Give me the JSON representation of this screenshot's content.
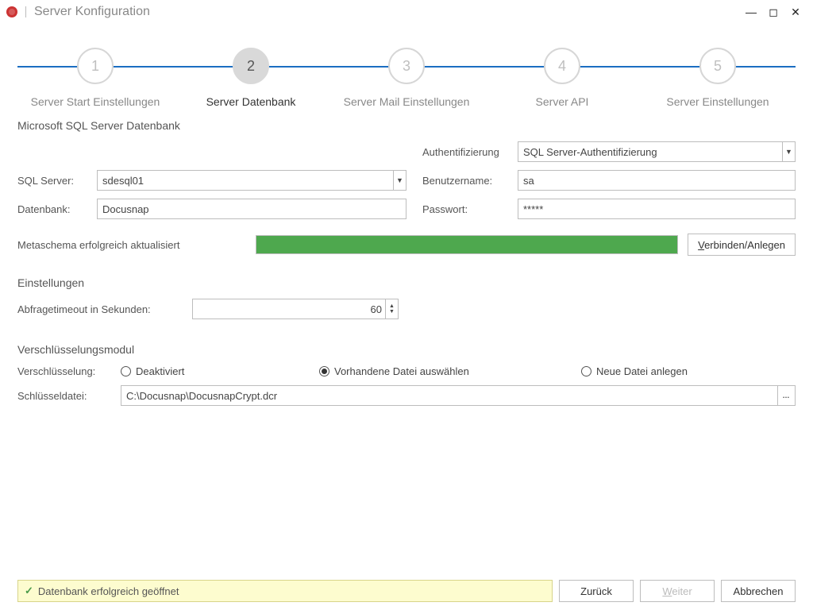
{
  "window": {
    "title": "Server Konfiguration"
  },
  "stepper": {
    "steps": [
      {
        "num": "1",
        "label": "Server Start Einstellungen"
      },
      {
        "num": "2",
        "label": "Server Datenbank"
      },
      {
        "num": "3",
        "label": "Server Mail Einstellungen"
      },
      {
        "num": "4",
        "label": "Server API"
      },
      {
        "num": "5",
        "label": "Server Einstellungen"
      }
    ],
    "active_index": 1
  },
  "db": {
    "section_title": "Microsoft SQL Server Datenbank",
    "auth_label": "Authentifizierung",
    "auth_value": "SQL Server-Authentifizierung",
    "sqlserver_label": "SQL Server:",
    "sqlserver_value": "sdesql01",
    "dbname_label": "Datenbank:",
    "dbname_value": "Docusnap",
    "user_label": "Benutzername:",
    "user_value": "sa",
    "pass_label": "Passwort:",
    "pass_value": "*****",
    "connect_button": "Verbinden/Anlegen",
    "meta_status": "Metaschema erfolgreich aktualisiert"
  },
  "settings": {
    "section_title": "Einstellungen",
    "timeout_label": "Abfragetimeout in Sekunden:",
    "timeout_value": "60"
  },
  "crypt": {
    "section_title": "Verschlüsselungsmodul",
    "mode_label": "Verschlüsselung:",
    "opt_disabled": "Deaktiviert",
    "opt_existing": "Vorhandene Datei auswählen",
    "opt_new": "Neue Datei anlegen",
    "selected": "existing",
    "keyfile_label": "Schlüsseldatei:",
    "keyfile_value": "C:\\Docusnap\\DocusnapCrypt.dcr"
  },
  "footer": {
    "status_text": "Datenbank erfolgreich geöffnet",
    "back": "Zurück",
    "next": "Weiter",
    "cancel": "Abbrechen"
  }
}
